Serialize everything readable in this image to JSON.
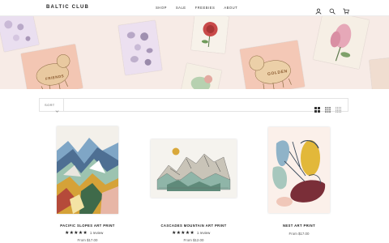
{
  "header": {
    "logo": "BALTIC CLUB",
    "nav": [
      "SHOP",
      "SALE",
      "FREEBIES",
      "ABOUT"
    ],
    "icons": [
      "account-icon",
      "search-icon",
      "cart-icon"
    ]
  },
  "hero": {
    "cards": [
      {
        "text": "FRIENDS"
      },
      {
        "text": "GOLDEN"
      }
    ]
  },
  "filter": {
    "sort_label": "SORT",
    "view_options": [
      "grid-large-icon",
      "grid-medium-icon",
      "grid-small-icon"
    ]
  },
  "products": [
    {
      "title": "PACIFIC SLOPES ART PRINT",
      "stars": "★★★★★",
      "review": "1 review",
      "price": "From $17.00"
    },
    {
      "title": "CASCADES MOUNTAIN ART PRINT",
      "stars": "★★★★★",
      "review": "1 review",
      "price": "From $12.00"
    },
    {
      "title": "NEST ART PRINT",
      "price": "From $17.00"
    }
  ],
  "colors": {
    "hero_bg": "#f7ebe6",
    "card_peach": "#f4c9b8",
    "card_cream": "#f7f1e8",
    "card_lilac": "#ecdff0",
    "accent_dark": "#222222"
  }
}
